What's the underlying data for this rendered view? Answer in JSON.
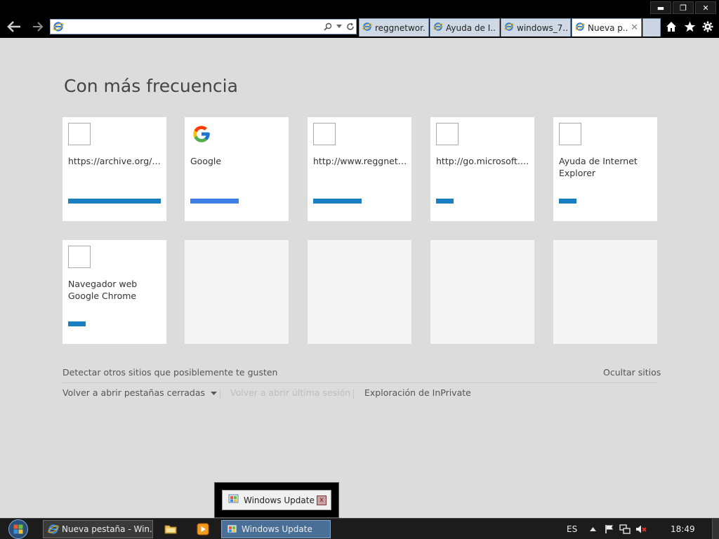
{
  "window": {
    "minimize_glyph": "▬",
    "restore_glyph": "❐",
    "close_glyph": "✕"
  },
  "nav": {
    "back_icon": "back-arrow-icon",
    "forward_icon": "forward-arrow-icon",
    "address_value": "",
    "tabs": [
      {
        "label": "reggnetwor...",
        "active": false
      },
      {
        "label": "Ayuda de I...",
        "active": false
      },
      {
        "label": "windows_7...",
        "active": false
      },
      {
        "label": "Nueva p...",
        "active": true
      }
    ],
    "tab_close_glyph": "✕"
  },
  "content": {
    "heading": "Con más frecuencia",
    "tiles_row1": [
      {
        "label": "https://archive.org/c...",
        "bar_fraction": 1.0,
        "icon": "blank"
      },
      {
        "label": "Google",
        "bar_fraction": 0.52,
        "icon": "google"
      },
      {
        "label": "http://www.reggnetw...",
        "bar_fraction": 0.52,
        "icon": "blank"
      },
      {
        "label": "http://go.microsoft.c...",
        "bar_fraction": 0.19,
        "icon": "blank"
      },
      {
        "label": "Ayuda de Internet Explorer",
        "bar_fraction": 0.19,
        "icon": "blank"
      }
    ],
    "tiles_row2": [
      {
        "label": "Navegador web Google Chrome",
        "bar_fraction": 0.19,
        "icon": "blank"
      }
    ],
    "suggest": "Detectar otros sitios que posiblemente te gusten",
    "hide_sites": "Ocultar sitios",
    "reopen_tabs": "Volver a abrir pestañas cerradas",
    "reopen_session": "Volver a abrir última sesión",
    "inprivate": "Exploración de InPrivate"
  },
  "popup": {
    "title": "Windows Update",
    "close_glyph": "x"
  },
  "taskbar": {
    "tasks": [
      {
        "label": "Nueva pestaña - Win...",
        "active": false
      },
      {
        "label": "Windows Update",
        "active": true
      }
    ],
    "lang": "ES",
    "clock": "18:49"
  },
  "colors": {
    "accent_bar": "#1a7fc0",
    "google_bar": "#3d7fe6",
    "background": "#dcdcdc"
  }
}
